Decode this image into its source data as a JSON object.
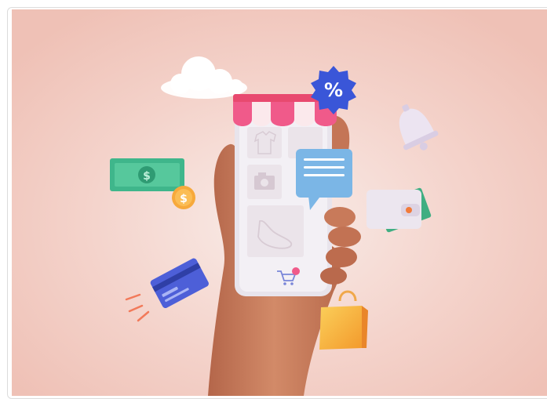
{
  "illustration": {
    "badge_text": "%",
    "coin_text": "$",
    "banknote_text": "$",
    "colors": {
      "background": "#f2c9c0",
      "awning_pink": "#f05a8a",
      "awning_white": "#fbe9ec",
      "phone_body": "#f1eef3",
      "badge_blue": "#3a56d8",
      "chat_blue": "#7bb6e6",
      "banknote_green": "#3fb68b",
      "coin_orange": "#f7a93b",
      "card_blue": "#4d5fd8",
      "bag_orange": "#f5b23d",
      "hand_skin": "#c87a5a",
      "cloud": "#ffffff"
    },
    "icons": [
      "cloud-icon",
      "discount-badge-icon",
      "bell-icon",
      "banknote-icon",
      "coin-icon",
      "credit-card-icon",
      "wallet-icon",
      "shopping-bag-icon",
      "shopping-cart-icon",
      "chat-bubble-icon",
      "sneaker-icon",
      "camera-icon",
      "shirt-icon",
      "store-awning-icon"
    ]
  }
}
